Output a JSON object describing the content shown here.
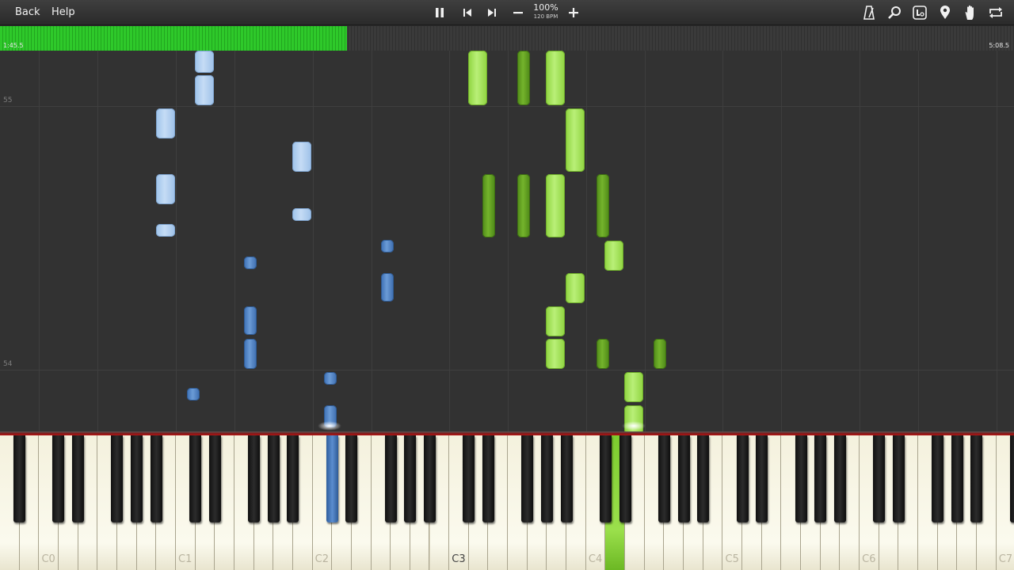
{
  "topbar": {
    "back_label": "Back",
    "help_label": "Help",
    "speed_percent": "100%",
    "tempo": "120 BPM"
  },
  "icons": {
    "pause": "pause-icon",
    "previous": "skip-previous-icon",
    "next": "skip-next-icon",
    "slower": "minus-icon",
    "faster": "plus-icon",
    "metronome": "metronome-icon",
    "zoom": "magnifier-icon",
    "labels": "note-labels-icon",
    "bookmark": "map-pin-icon",
    "hands": "hand-icon",
    "loop": "loop-icon"
  },
  "progress": {
    "current": "1:45.5",
    "total": "5:08.5",
    "fraction": 0.3418
  },
  "roll": {
    "measure_upper": "55",
    "measure_lower": "54"
  },
  "keyboard": {
    "octave_labels": [
      "C0",
      "C1",
      "C2",
      "C3",
      "C4",
      "C5",
      "C6",
      "C7"
    ],
    "current_octave": "C3",
    "pressed_keys": [
      "C#2",
      "D4"
    ]
  },
  "colors": {
    "left_hand_light": "#b4d2f2",
    "left_hand_dark": "#4f82c4",
    "right_hand_light": "#a8e85e",
    "right_hand_dark": "#5f9d1f",
    "progress_green": "#2ec92a"
  }
}
